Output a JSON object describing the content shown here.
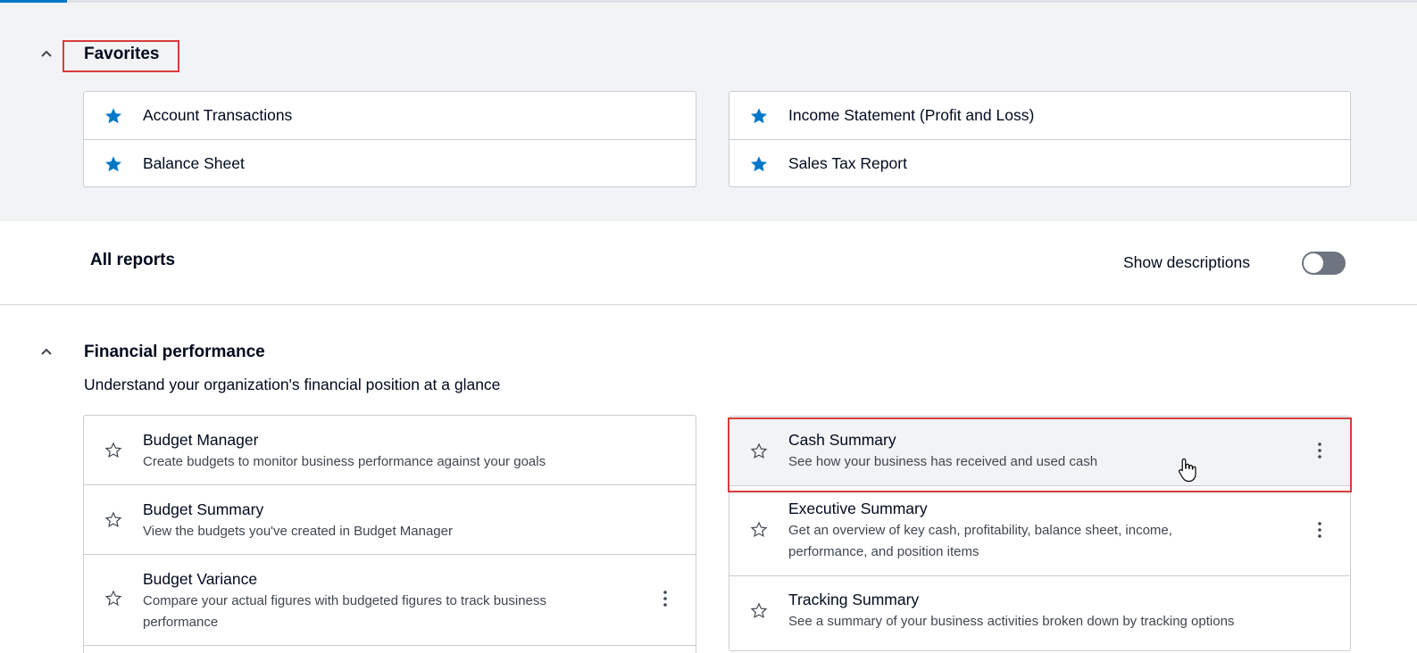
{
  "favorites": {
    "title": "Favorites",
    "left": [
      {
        "label": "Account Transactions"
      },
      {
        "label": "Balance Sheet"
      }
    ],
    "right": [
      {
        "label": "Income Statement (Profit and Loss)"
      },
      {
        "label": "Sales Tax Report"
      }
    ]
  },
  "all_reports": {
    "title": "All reports",
    "toggle_label": "Show descriptions",
    "toggle_on": false
  },
  "financial_performance": {
    "title": "Financial performance",
    "description": "Understand your organization's financial position at a glance",
    "left": [
      {
        "title": "Budget Manager",
        "description": "Create budgets to monitor business performance against your goals"
      },
      {
        "title": "Budget Summary",
        "description": "View the budgets you've created in Budget Manager"
      },
      {
        "title": "Budget Variance",
        "description": "Compare your actual figures with budgeted figures to track business performance"
      }
    ],
    "right": [
      {
        "title": "Cash Summary",
        "description": "See how your business has received and used cash"
      },
      {
        "title": "Executive Summary",
        "description": "Get an overview of key cash, profitability, balance sheet, income, performance, and position items"
      },
      {
        "title": "Tracking Summary",
        "description": "See a summary of your business activities broken down by tracking options"
      }
    ]
  },
  "colors": {
    "accent": "#0078c8",
    "highlight": "#d93b3b",
    "section_bg": "#f2f3f5"
  }
}
